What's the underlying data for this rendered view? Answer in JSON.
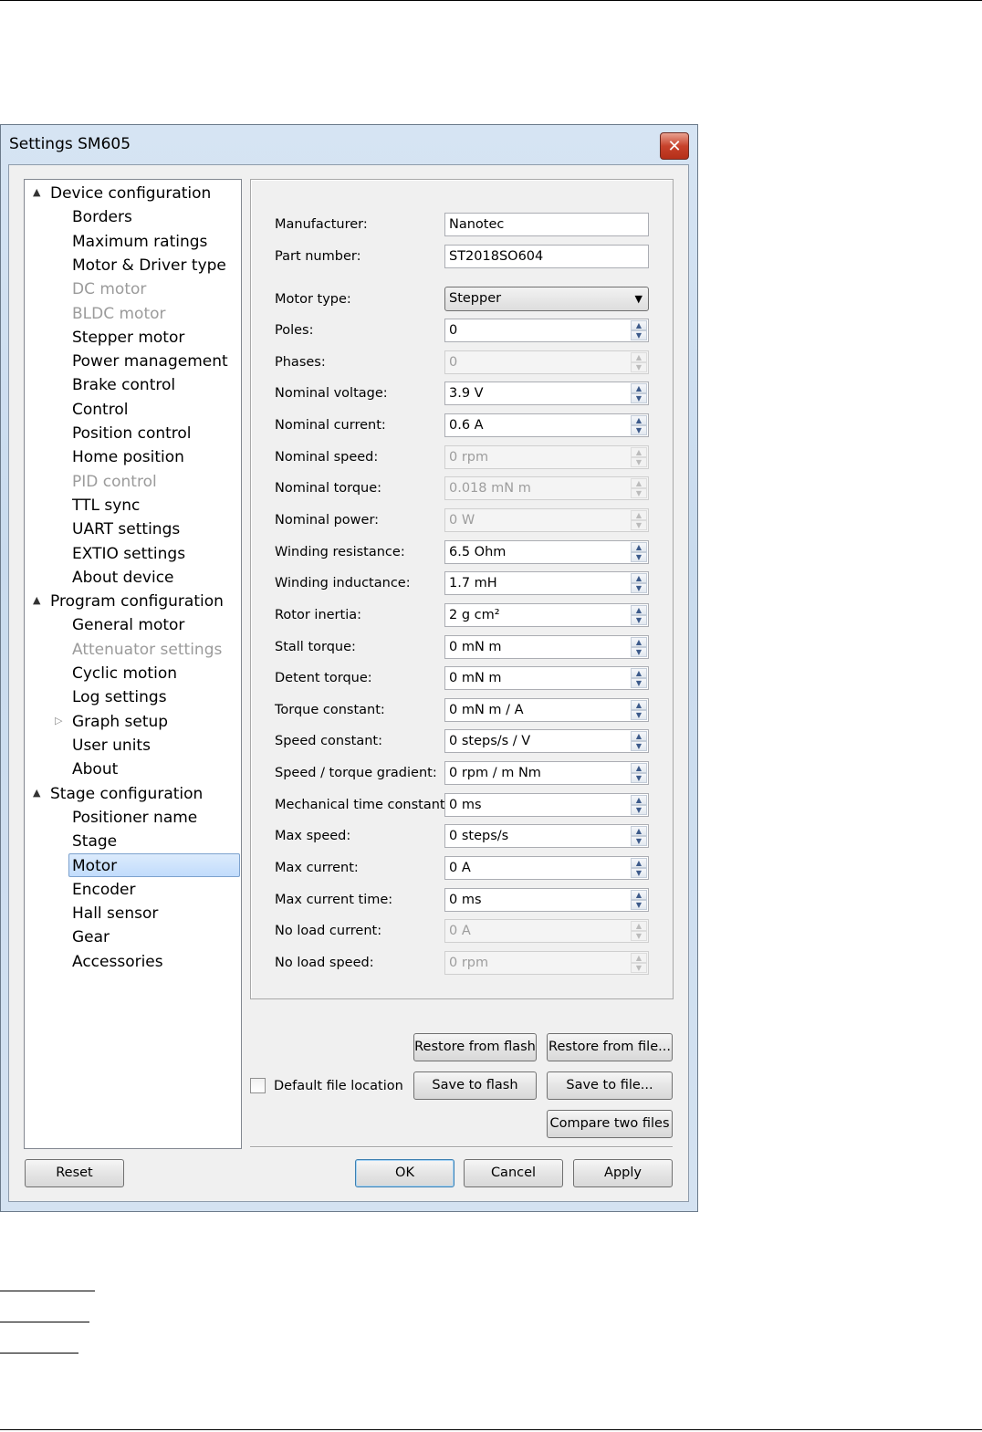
{
  "window": {
    "title": "Settings SM605",
    "close_glyph": "✕"
  },
  "tree": {
    "items": [
      {
        "label": "Device configuration",
        "level": 0,
        "expander": "▲",
        "state": "normal"
      },
      {
        "label": "Borders",
        "level": 1,
        "state": "normal"
      },
      {
        "label": "Maximum ratings",
        "level": 1,
        "state": "normal"
      },
      {
        "label": "Motor & Driver type",
        "level": 1,
        "state": "normal"
      },
      {
        "label": "DC motor",
        "level": 1,
        "state": "disabled"
      },
      {
        "label": "BLDC motor",
        "level": 1,
        "state": "disabled"
      },
      {
        "label": "Stepper motor",
        "level": 1,
        "state": "normal"
      },
      {
        "label": "Power management",
        "level": 1,
        "state": "normal"
      },
      {
        "label": "Brake control",
        "level": 1,
        "state": "normal"
      },
      {
        "label": "Control",
        "level": 1,
        "state": "normal"
      },
      {
        "label": "Position control",
        "level": 1,
        "state": "normal"
      },
      {
        "label": "Home position",
        "level": 1,
        "state": "normal"
      },
      {
        "label": "PID control",
        "level": 1,
        "state": "disabled"
      },
      {
        "label": "TTL sync",
        "level": 1,
        "state": "normal"
      },
      {
        "label": "UART settings",
        "level": 1,
        "state": "normal"
      },
      {
        "label": "EXTIO settings",
        "level": 1,
        "state": "normal"
      },
      {
        "label": "About device",
        "level": 1,
        "state": "normal"
      },
      {
        "label": "Program configuration",
        "level": 0,
        "expander": "▲",
        "state": "normal"
      },
      {
        "label": "General motor",
        "level": 1,
        "state": "normal"
      },
      {
        "label": "Attenuator settings",
        "level": 1,
        "state": "disabled"
      },
      {
        "label": "Cyclic motion",
        "level": 1,
        "state": "normal"
      },
      {
        "label": "Log settings",
        "level": 1,
        "state": "normal"
      },
      {
        "label": "Graph setup",
        "level": 1,
        "expander": "▷",
        "state": "normal"
      },
      {
        "label": "User units",
        "level": 1,
        "state": "normal"
      },
      {
        "label": "About",
        "level": 1,
        "state": "normal"
      },
      {
        "label": "Stage configuration",
        "level": 0,
        "expander": "▲",
        "state": "normal"
      },
      {
        "label": "Positioner name",
        "level": 1,
        "state": "normal"
      },
      {
        "label": "Stage",
        "level": 1,
        "state": "normal"
      },
      {
        "label": "Motor",
        "level": 1,
        "state": "selected"
      },
      {
        "label": "Encoder",
        "level": 1,
        "state": "normal"
      },
      {
        "label": "Hall sensor",
        "level": 1,
        "state": "normal"
      },
      {
        "label": "Gear",
        "level": 1,
        "state": "normal"
      },
      {
        "label": "Accessories",
        "level": 1,
        "state": "normal"
      }
    ]
  },
  "form": {
    "manufacturer_label": "Manufacturer:",
    "manufacturer_value": "Nanotec",
    "part_number_label": "Part number:",
    "part_number_value": "ST2018SO604",
    "motor_type_label": "Motor type:",
    "motor_type_value": "Stepper",
    "fields": [
      {
        "label": "Poles:",
        "value": "0",
        "enabled": true
      },
      {
        "label": "Phases:",
        "value": "0",
        "enabled": false
      },
      {
        "label": "Nominal voltage:",
        "value": "3.9 V",
        "enabled": true
      },
      {
        "label": "Nominal current:",
        "value": "0.6 A",
        "enabled": true
      },
      {
        "label": "Nominal speed:",
        "value": "0 rpm",
        "enabled": false
      },
      {
        "label": "Nominal torque:",
        "value": "0.018 mN m",
        "enabled": false
      },
      {
        "label": "Nominal power:",
        "value": "0 W",
        "enabled": false
      },
      {
        "label": "Winding resistance:",
        "value": "6.5 Ohm",
        "enabled": true
      },
      {
        "label": "Winding inductance:",
        "value": "1.7 mH",
        "enabled": true
      },
      {
        "label": "Rotor inertia:",
        "value": "2 g cm²",
        "enabled": true
      },
      {
        "label": "Stall torque:",
        "value": "0 mN m",
        "enabled": true
      },
      {
        "label": "Detent torque:",
        "value": "0 mN m",
        "enabled": true
      },
      {
        "label": "Torque constant:",
        "value": "0 mN m / A",
        "enabled": true
      },
      {
        "label": "Speed constant:",
        "value": "0 steps/s / V",
        "enabled": true
      },
      {
        "label": "Speed / torque gradient:",
        "value": "0 rpm / m Nm",
        "enabled": true
      },
      {
        "label": "Mechanical time constant:",
        "value": "0 ms",
        "enabled": true
      },
      {
        "label": "Max speed:",
        "value": "0 steps/s",
        "enabled": true
      },
      {
        "label": "Max current:",
        "value": "0 A",
        "enabled": true
      },
      {
        "label": "Max current time:",
        "value": "0 ms",
        "enabled": true
      },
      {
        "label": "No load current:",
        "value": "0 A",
        "enabled": false
      },
      {
        "label": "No load speed:",
        "value": "0 rpm",
        "enabled": false
      }
    ]
  },
  "file_buttons": {
    "restore_flash": "Restore from flash",
    "restore_file": "Restore from file...",
    "save_flash": "Save to flash",
    "save_file": "Save to file...",
    "compare": "Compare two files",
    "default_location_label": "Default file location"
  },
  "dialog_buttons": {
    "reset": "Reset",
    "ok": "OK",
    "cancel": "Cancel",
    "apply": "Apply"
  }
}
